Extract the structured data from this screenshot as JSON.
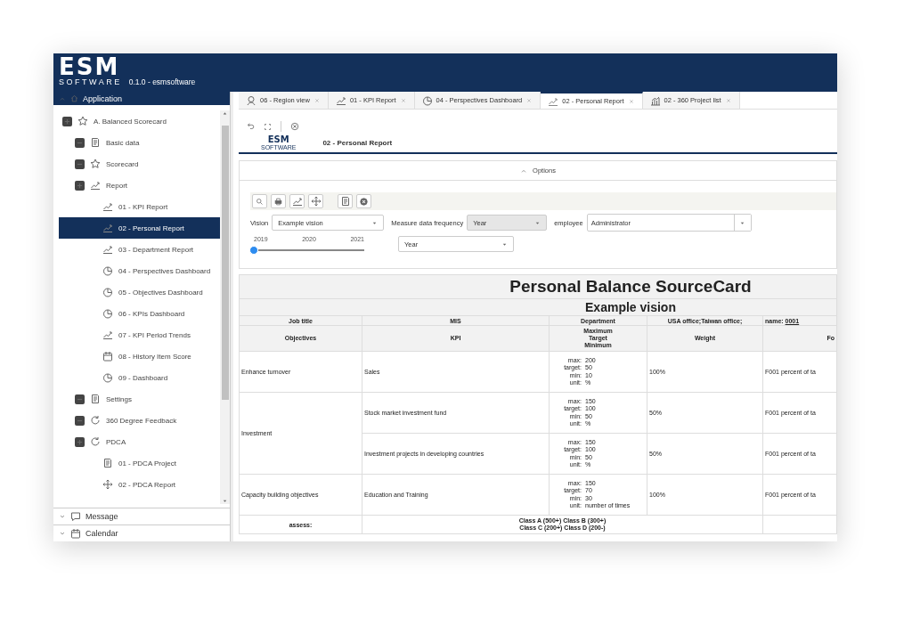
{
  "header": {
    "logo_main": "ESM",
    "logo_sub": "SOFTWARE",
    "version": "0.1.0 - esmsoftware"
  },
  "sidebar": {
    "title": "Application",
    "tree": [
      {
        "label": "A. Balanced Scorecard",
        "expanded": true,
        "kind": "star",
        "selected": false,
        "children": [
          {
            "label": "Basic data",
            "expanded": false,
            "kind": "doc",
            "selected": false
          },
          {
            "label": "Scorecard",
            "expanded": false,
            "kind": "star",
            "selected": false
          },
          {
            "label": "Report",
            "expanded": true,
            "kind": "chart",
            "selected": false,
            "children": [
              {
                "label": "01 - KPI Report",
                "kind": "chart",
                "selected": false
              },
              {
                "label": "02 - Personal Report",
                "kind": "chart",
                "selected": true
              },
              {
                "label": "03 - Department Report",
                "kind": "chart",
                "selected": false
              },
              {
                "label": "04 - Perspectives Dashboard",
                "kind": "pie",
                "selected": false
              },
              {
                "label": "05 - Objectives Dashboard",
                "kind": "pie",
                "selected": false
              },
              {
                "label": "06 - KPIs Dashboard",
                "kind": "pie",
                "selected": false
              },
              {
                "label": "07 - KPI Period Trends",
                "kind": "chart",
                "selected": false
              },
              {
                "label": "08 - History Item Score",
                "kind": "calendar",
                "selected": false
              },
              {
                "label": "09 - Dashboard",
                "kind": "pie",
                "selected": false
              }
            ]
          },
          {
            "label": "Settings",
            "expanded": false,
            "kind": "doc",
            "selected": false
          },
          {
            "label": "360 Degree Feedback",
            "expanded": false,
            "kind": "cycle",
            "selected": false
          },
          {
            "label": "PDCA",
            "expanded": true,
            "kind": "cycle",
            "selected": false,
            "children": [
              {
                "label": "01 - PDCA Project",
                "kind": "doc",
                "selected": false
              },
              {
                "label": "02 - PDCA Report",
                "kind": "move",
                "selected": false
              }
            ]
          }
        ]
      }
    ],
    "panels": [
      {
        "label": "Message",
        "kind": "chat"
      },
      {
        "label": "Calendar",
        "kind": "calendar"
      }
    ]
  },
  "tabs": [
    {
      "label": "06 - Region view",
      "kind": "pin",
      "selected": false
    },
    {
      "label": "01 - KPI Report",
      "kind": "chart",
      "selected": false
    },
    {
      "label": "04 - Perspectives Dashboard",
      "kind": "pie",
      "selected": false
    },
    {
      "label": "02 - Personal Report",
      "kind": "chart",
      "selected": true
    },
    {
      "label": "02 - 360 Project list",
      "kind": "bars",
      "selected": false
    }
  ],
  "page": {
    "logo_main": "ESM",
    "logo_sub": "SOFTWARE",
    "title": "02 - Personal Report"
  },
  "options": {
    "label": "Options",
    "vision": {
      "label": "Vision",
      "value": "Example vision"
    },
    "frequency": {
      "label": "Measure data frequency",
      "value": "Year",
      "disabled": true
    },
    "employee": {
      "label": "employee",
      "value": "Administrator"
    },
    "slider": {
      "ticks": [
        "2019",
        "2020",
        "2021"
      ],
      "level": 0
    },
    "period": {
      "value": "Year"
    }
  },
  "report": {
    "title": "Personal Balance SourceCard",
    "subtitle": "Example vision",
    "info": [
      "Job title",
      "MIS",
      "Department",
      "USA office;Taiwan office;"
    ],
    "name_label": "name:",
    "name_value": "0001",
    "columns": [
      "Objectives",
      "KPI",
      "Maximum\nTarget\nMinimum",
      "Weight",
      "Fo"
    ],
    "objectives": [
      {
        "name": "Enhance turnover",
        "kpis": [
          {
            "name": "Sales",
            "limits": [
              {
                "label": "max:",
                "value": "200"
              },
              {
                "label": "target:",
                "value": "50"
              },
              {
                "label": "min:",
                "value": "10"
              },
              {
                "label": "unit:",
                "value": "%"
              }
            ],
            "weight": "100%",
            "formula": "F001 percent of ta"
          }
        ]
      },
      {
        "name": "Investment",
        "kpis": [
          {
            "name": "Stock market investment fund",
            "limits": [
              {
                "label": "max:",
                "value": "150"
              },
              {
                "label": "target:",
                "value": "100"
              },
              {
                "label": "min:",
                "value": "50"
              },
              {
                "label": "unit:",
                "value": "%"
              }
            ],
            "weight": "50%",
            "formula": "F001 percent of ta"
          },
          {
            "name": "Investment projects in developing countries",
            "limits": [
              {
                "label": "max:",
                "value": "150"
              },
              {
                "label": "target:",
                "value": "100"
              },
              {
                "label": "min:",
                "value": "50"
              },
              {
                "label": "unit:",
                "value": "%"
              }
            ],
            "weight": "50%",
            "formula": "F001 percent of ta"
          }
        ]
      },
      {
        "name": "Capacity building objectives",
        "kpis": [
          {
            "name": "Education and Training",
            "limits": [
              {
                "label": "max:",
                "value": "150"
              },
              {
                "label": "target:",
                "value": "70"
              },
              {
                "label": "min:",
                "value": "30"
              },
              {
                "label": "unit:",
                "value": "number of times"
              }
            ],
            "weight": "100%",
            "formula": "F001 percent of ta"
          }
        ]
      }
    ],
    "assess": {
      "label": "assess:",
      "text": "Class A (500+) Class B (300+)\nClass C (200+) Class D (200-)"
    }
  }
}
